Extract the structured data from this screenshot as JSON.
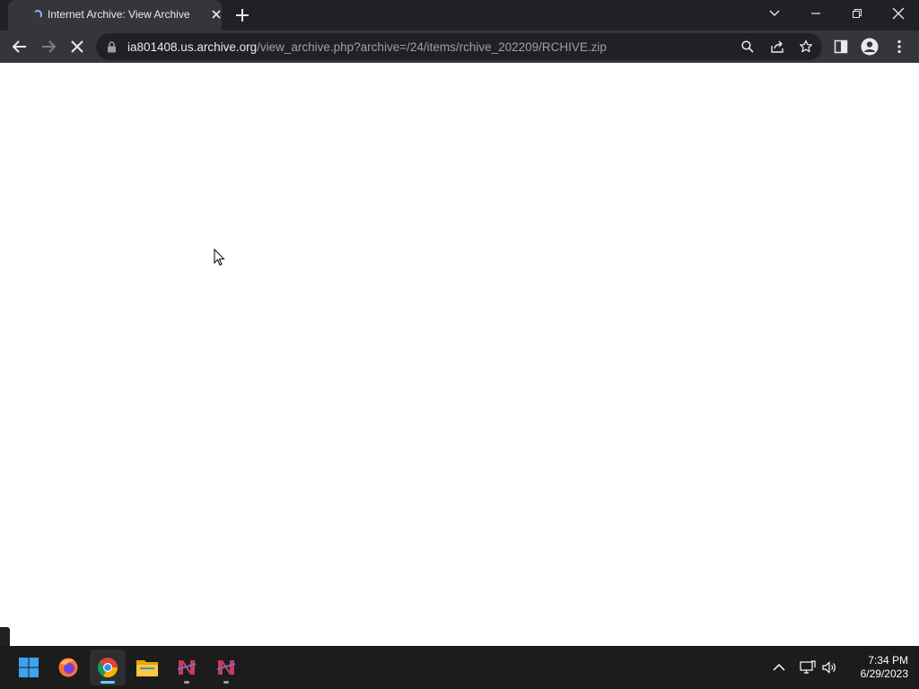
{
  "browser": {
    "tab_title": "Internet Archive: View Archive",
    "url_host": "ia801408.us.archive.org",
    "url_path": "/view_archive.php?archive=/24/items/rchive_202209/RCHIVE.zip",
    "accent_color": "#8ab4f8"
  },
  "taskbar": {
    "apps": [
      "windows-start",
      "firefox",
      "chrome",
      "file-explorer",
      "app-n-1",
      "app-n-2"
    ],
    "time": "7:34 PM",
    "date": "6/29/2023"
  }
}
